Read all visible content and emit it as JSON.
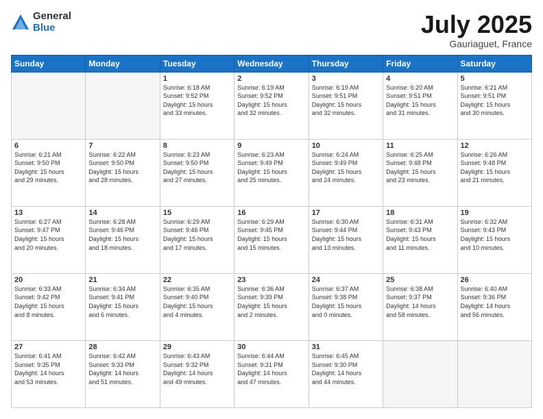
{
  "logo": {
    "general": "General",
    "blue": "Blue"
  },
  "header": {
    "title": "July 2025",
    "subtitle": "Gauriaguet, France"
  },
  "calendar": {
    "headers": [
      "Sunday",
      "Monday",
      "Tuesday",
      "Wednesday",
      "Thursday",
      "Friday",
      "Saturday"
    ],
    "weeks": [
      [
        {
          "day": "",
          "info": ""
        },
        {
          "day": "",
          "info": ""
        },
        {
          "day": "1",
          "info": "Sunrise: 6:18 AM\nSunset: 9:52 PM\nDaylight: 15 hours\nand 33 minutes."
        },
        {
          "day": "2",
          "info": "Sunrise: 6:19 AM\nSunset: 9:52 PM\nDaylight: 15 hours\nand 32 minutes."
        },
        {
          "day": "3",
          "info": "Sunrise: 6:19 AM\nSunset: 9:51 PM\nDaylight: 15 hours\nand 32 minutes."
        },
        {
          "day": "4",
          "info": "Sunrise: 6:20 AM\nSunset: 9:51 PM\nDaylight: 15 hours\nand 31 minutes."
        },
        {
          "day": "5",
          "info": "Sunrise: 6:21 AM\nSunset: 9:51 PM\nDaylight: 15 hours\nand 30 minutes."
        }
      ],
      [
        {
          "day": "6",
          "info": "Sunrise: 6:21 AM\nSunset: 9:50 PM\nDaylight: 15 hours\nand 29 minutes."
        },
        {
          "day": "7",
          "info": "Sunrise: 6:22 AM\nSunset: 9:50 PM\nDaylight: 15 hours\nand 28 minutes."
        },
        {
          "day": "8",
          "info": "Sunrise: 6:23 AM\nSunset: 9:50 PM\nDaylight: 15 hours\nand 27 minutes."
        },
        {
          "day": "9",
          "info": "Sunrise: 6:23 AM\nSunset: 9:49 PM\nDaylight: 15 hours\nand 25 minutes."
        },
        {
          "day": "10",
          "info": "Sunrise: 6:24 AM\nSunset: 9:49 PM\nDaylight: 15 hours\nand 24 minutes."
        },
        {
          "day": "11",
          "info": "Sunrise: 6:25 AM\nSunset: 9:48 PM\nDaylight: 15 hours\nand 23 minutes."
        },
        {
          "day": "12",
          "info": "Sunrise: 6:26 AM\nSunset: 9:48 PM\nDaylight: 15 hours\nand 21 minutes."
        }
      ],
      [
        {
          "day": "13",
          "info": "Sunrise: 6:27 AM\nSunset: 9:47 PM\nDaylight: 15 hours\nand 20 minutes."
        },
        {
          "day": "14",
          "info": "Sunrise: 6:28 AM\nSunset: 9:46 PM\nDaylight: 15 hours\nand 18 minutes."
        },
        {
          "day": "15",
          "info": "Sunrise: 6:29 AM\nSunset: 9:46 PM\nDaylight: 15 hours\nand 17 minutes."
        },
        {
          "day": "16",
          "info": "Sunrise: 6:29 AM\nSunset: 9:45 PM\nDaylight: 15 hours\nand 15 minutes."
        },
        {
          "day": "17",
          "info": "Sunrise: 6:30 AM\nSunset: 9:44 PM\nDaylight: 15 hours\nand 13 minutes."
        },
        {
          "day": "18",
          "info": "Sunrise: 6:31 AM\nSunset: 9:43 PM\nDaylight: 15 hours\nand 11 minutes."
        },
        {
          "day": "19",
          "info": "Sunrise: 6:32 AM\nSunset: 9:43 PM\nDaylight: 15 hours\nand 10 minutes."
        }
      ],
      [
        {
          "day": "20",
          "info": "Sunrise: 6:33 AM\nSunset: 9:42 PM\nDaylight: 15 hours\nand 8 minutes."
        },
        {
          "day": "21",
          "info": "Sunrise: 6:34 AM\nSunset: 9:41 PM\nDaylight: 15 hours\nand 6 minutes."
        },
        {
          "day": "22",
          "info": "Sunrise: 6:35 AM\nSunset: 9:40 PM\nDaylight: 15 hours\nand 4 minutes."
        },
        {
          "day": "23",
          "info": "Sunrise: 6:36 AM\nSunset: 9:39 PM\nDaylight: 15 hours\nand 2 minutes."
        },
        {
          "day": "24",
          "info": "Sunrise: 6:37 AM\nSunset: 9:38 PM\nDaylight: 15 hours\nand 0 minutes."
        },
        {
          "day": "25",
          "info": "Sunrise: 6:38 AM\nSunset: 9:37 PM\nDaylight: 14 hours\nand 58 minutes."
        },
        {
          "day": "26",
          "info": "Sunrise: 6:40 AM\nSunset: 9:36 PM\nDaylight: 14 hours\nand 56 minutes."
        }
      ],
      [
        {
          "day": "27",
          "info": "Sunrise: 6:41 AM\nSunset: 9:35 PM\nDaylight: 14 hours\nand 53 minutes."
        },
        {
          "day": "28",
          "info": "Sunrise: 6:42 AM\nSunset: 9:33 PM\nDaylight: 14 hours\nand 51 minutes."
        },
        {
          "day": "29",
          "info": "Sunrise: 6:43 AM\nSunset: 9:32 PM\nDaylight: 14 hours\nand 49 minutes."
        },
        {
          "day": "30",
          "info": "Sunrise: 6:44 AM\nSunset: 9:31 PM\nDaylight: 14 hours\nand 47 minutes."
        },
        {
          "day": "31",
          "info": "Sunrise: 6:45 AM\nSunset: 9:30 PM\nDaylight: 14 hours\nand 44 minutes."
        },
        {
          "day": "",
          "info": ""
        },
        {
          "day": "",
          "info": ""
        }
      ]
    ]
  }
}
